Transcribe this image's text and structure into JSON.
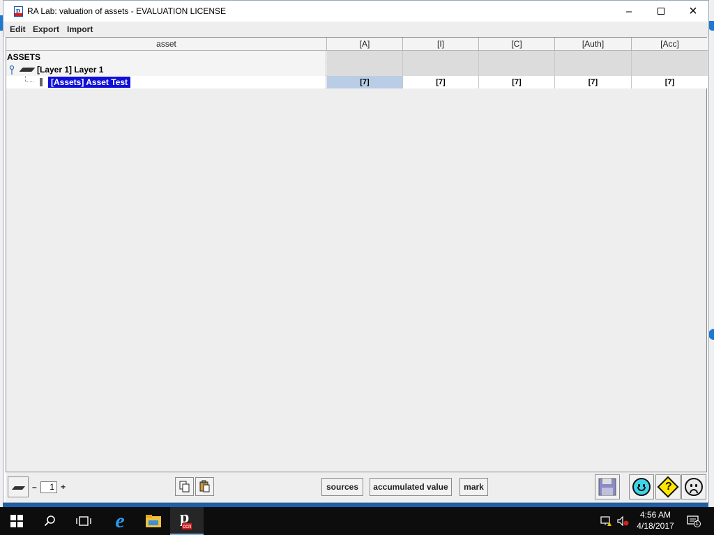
{
  "window": {
    "title": "RA Lab: valuation of assets - EVALUATION LICENSE"
  },
  "menu": [
    "Edit",
    "Export",
    "Import"
  ],
  "table": {
    "columns": [
      "asset",
      "[A]",
      "[I]",
      "[C]",
      "[Auth]",
      "[Acc]"
    ],
    "section_label": "ASSETS",
    "layer_label": "[Layer 1] Layer 1",
    "asset_label": "[Assets] Asset Test",
    "asset_values": [
      "[7]",
      "[7]",
      "[7]",
      "[7]",
      "[7]"
    ]
  },
  "bottom": {
    "page_minus": "–",
    "page_value": "1",
    "page_plus": "+",
    "sources_label": "sources",
    "accumulated_label": "accumulated value",
    "mark_label": "mark",
    "help_glyph": "?"
  },
  "taskbar": {
    "time": "4:56 AM",
    "date": "4/18/2017",
    "app_badge": "ccn",
    "notification_count": "1"
  },
  "colors": {
    "selection": "#1010d8",
    "selected_cell": "#b9cde6",
    "grid_gray": "#dcdcdc"
  },
  "icons": {
    "window_close": "×",
    "window_min": "–"
  }
}
